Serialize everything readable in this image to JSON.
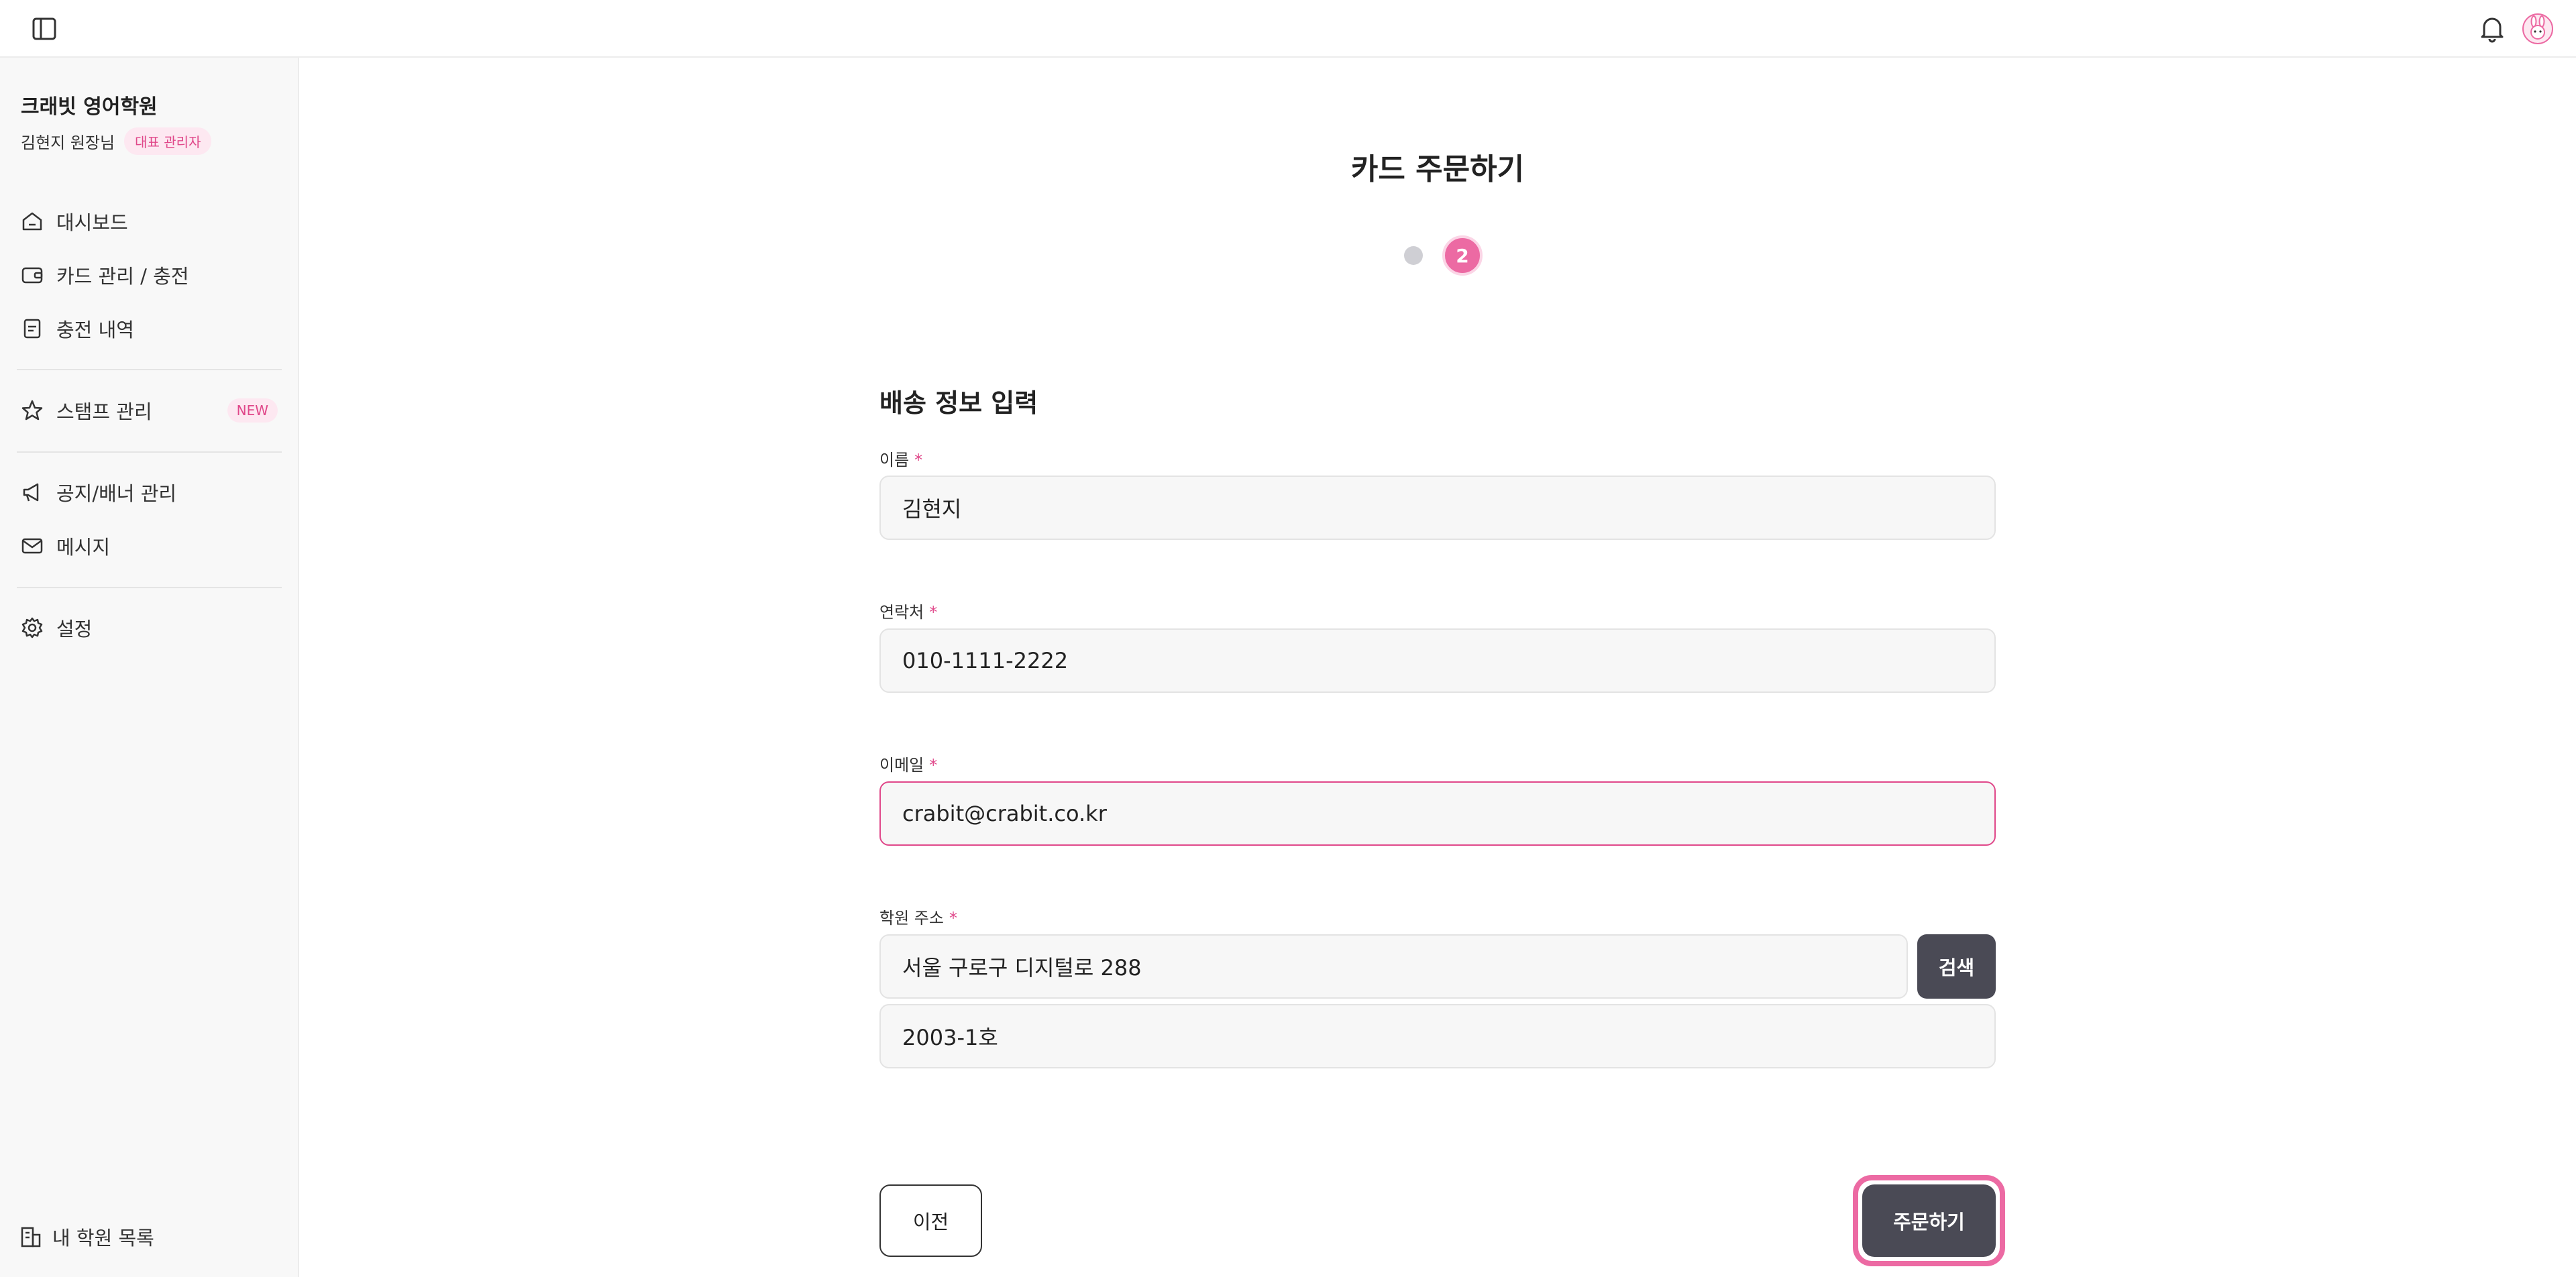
{
  "sidebar": {
    "org_name": "크래빗 영어학원",
    "user_name": "김현지 원장님",
    "role_badge": "대표 관리자",
    "nav": [
      {
        "label": "대시보드",
        "icon": "home-icon"
      },
      {
        "label": "카드 관리 / 충전",
        "icon": "wallet-icon"
      },
      {
        "label": "충전 내역",
        "icon": "receipt-icon"
      },
      {
        "label": "스탬프 관리",
        "icon": "star-icon",
        "badge": "NEW"
      },
      {
        "label": "공지/배너 관리",
        "icon": "megaphone-icon"
      },
      {
        "label": "메시지",
        "icon": "mail-icon"
      },
      {
        "label": "설정",
        "icon": "gear-icon"
      }
    ],
    "footer_link": "내 학원 목록"
  },
  "main": {
    "title": "카드 주문하기",
    "stepper": {
      "current_step": "2",
      "total_steps": 2
    },
    "section_title": "배송 정보 입력",
    "fields": {
      "name": {
        "label": "이름",
        "required_mark": "*",
        "value": "김현지"
      },
      "phone": {
        "label": "연락처",
        "required_mark": "*",
        "value": "010-1111-2222"
      },
      "email": {
        "label": "이메일",
        "required_mark": "*",
        "value": "crabit@crabit.co.kr"
      },
      "address": {
        "label": "학원 주소",
        "required_mark": "*",
        "value": "서울 구로구 디지털로 288",
        "detail_value": "2003-1호",
        "search_label": "검색"
      }
    },
    "prev_label": "이전",
    "submit_label": "주문하기"
  },
  "colors": {
    "accent": "#ec6aa3",
    "dark_button": "#4a4a55",
    "sidebar_bg": "#f8f8f8"
  }
}
